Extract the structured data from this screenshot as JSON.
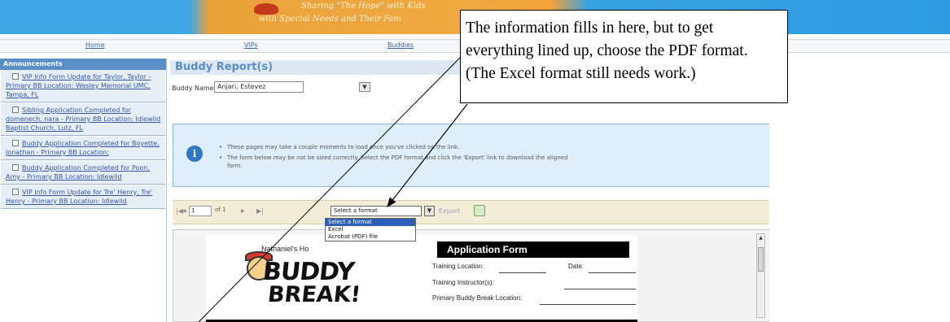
{
  "banner": {
    "tagline_1": "Sharing \"The Hope\" with Kids",
    "tagline_2": "with Special Needs and Their Fam"
  },
  "nav": {
    "items": [
      "Home",
      "VIPs",
      "Buddies"
    ]
  },
  "sidebar": {
    "title": "Announcements",
    "items": [
      "VIP Info Form Update for Taylor, Taylor - Primary BB Location: Wesley Memorial UMC, Tampa, FL",
      "Sibling Application Completed for domenech, nara - Primary BB Location: Idlewild Baptist Church, Lutz, FL",
      "Buddy Application Completed for Boyette, Jonathan - Primary BB Location:",
      "Buddy Application Completed for Poon, Amy - Primary BB Location: Idlewild",
      "VIP Info Form Update for Tre' Henry, Tre' Henry - Primary BB Location: Idlewild"
    ]
  },
  "main": {
    "title": "Buddy Report(s)",
    "buddy_label": "Buddy Name:",
    "buddy_value": "Anjari, Estevez",
    "info_lines": [
      "These pages may take a couple moments to load once you've clicked on the link.",
      "The form below may be not be sized correctly. Select the PDF format and click the 'Export' link to download the aligned",
      "form."
    ]
  },
  "toolbar": {
    "first": "|◀",
    "prev": "◀",
    "page": "1",
    "of": "of 1",
    "next": "▶",
    "last": "▶|",
    "format_value": "Select a format",
    "export": "Export",
    "format_options": [
      "Select a format",
      "Excel",
      "Acrobat (PDF) file"
    ]
  },
  "report": {
    "logo_small": "Nathaniel's Ho",
    "logo_line1": "BUDDY",
    "logo_line2": "BREAK!",
    "form_title": "Application Form",
    "training_location": "Training Location:",
    "date": "Date:",
    "training_instructor": "Training Instructor(s):",
    "primary_location": "Primary Buddy Break Location:"
  },
  "callout": {
    "lines": [
      "The information fills in here, but to get",
      "everything lined up, choose the PDF format.",
      "(The Excel format still needs work.)"
    ]
  }
}
